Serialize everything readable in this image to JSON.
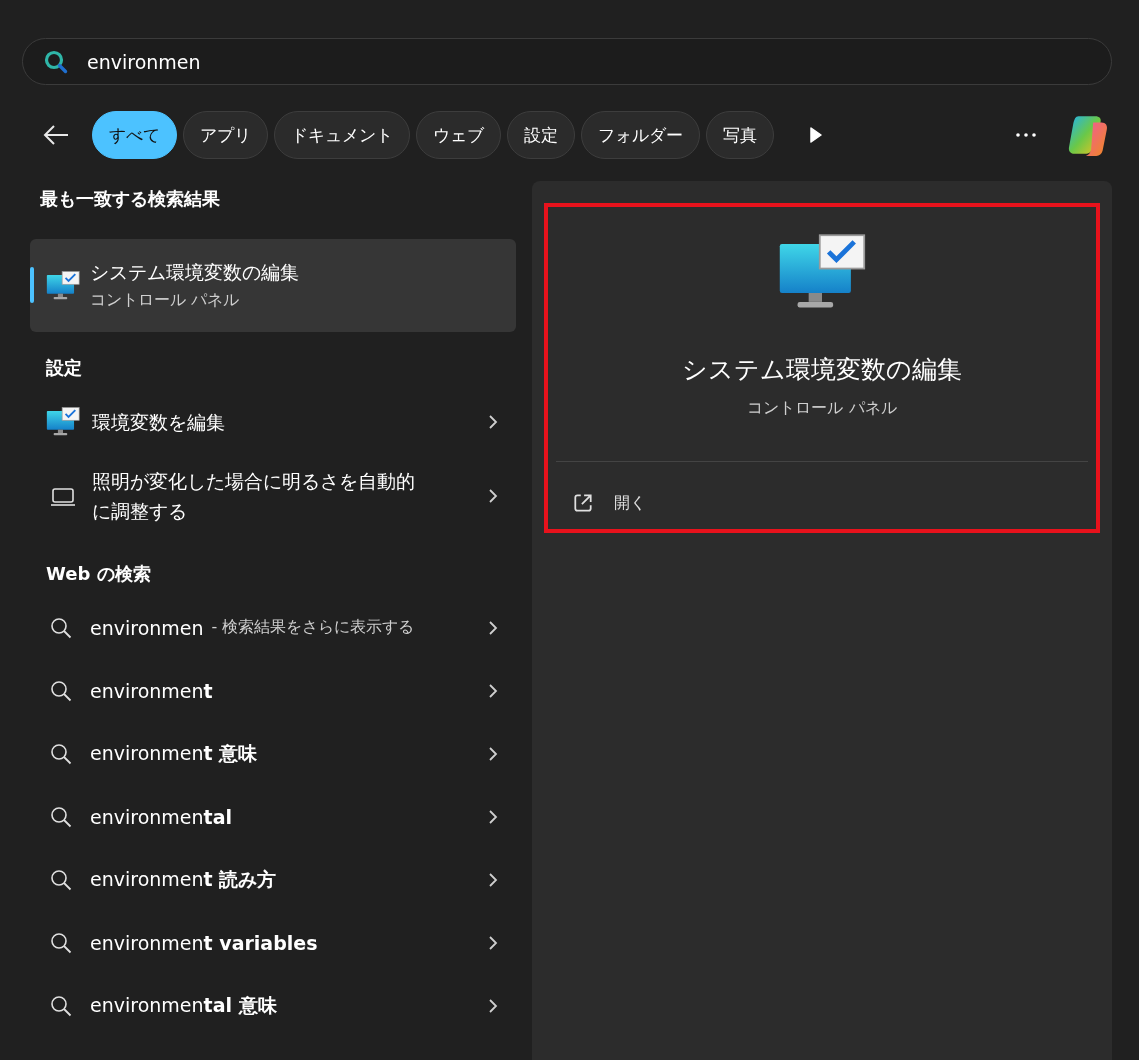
{
  "search": {
    "value": "environmen"
  },
  "filters": [
    {
      "label": "すべて",
      "selected": true
    },
    {
      "label": "アプリ",
      "selected": false
    },
    {
      "label": "ドキュメント",
      "selected": false
    },
    {
      "label": "ウェブ",
      "selected": false
    },
    {
      "label": "設定",
      "selected": false
    },
    {
      "label": "フォルダー",
      "selected": false
    },
    {
      "label": "写真",
      "selected": false
    }
  ],
  "best_match": {
    "heading": "最も一致する検索結果",
    "title": "システム環境変数の編集",
    "subtitle": "コントロール パネル",
    "selected": true
  },
  "settings": {
    "heading": "設定",
    "items": [
      {
        "kind": "monitor",
        "label": "環境変数を編集"
      },
      {
        "kind": "laptop",
        "label": "照明が変化した場合に明るさを自動的に調整する"
      }
    ]
  },
  "web": {
    "heading": "Web の検索",
    "items": [
      {
        "label": "environmen",
        "note": "- 検索結果をさらに表示する"
      },
      {
        "label": "environmen**t**"
      },
      {
        "label": "environmen**t 意味**"
      },
      {
        "label": "environmen**tal**"
      },
      {
        "label": "environmen**t 読み方**"
      },
      {
        "label": "environmen**t variables**"
      },
      {
        "label": "environmen**tal 意味**"
      }
    ]
  },
  "preview": {
    "title": "システム環境変数の編集",
    "subtitle": "コントロール パネル",
    "actions": [
      {
        "label": "開く"
      }
    ]
  }
}
